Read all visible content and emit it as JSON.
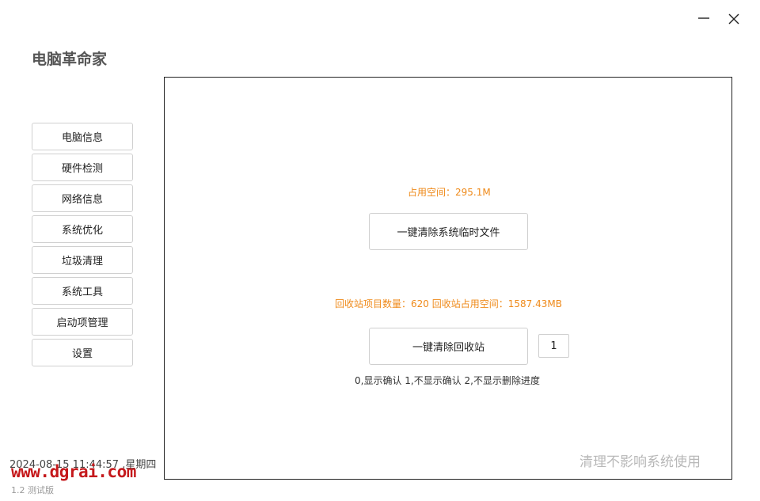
{
  "window": {
    "minimize_icon": "minimize-icon",
    "close_icon": "close-icon"
  },
  "app": {
    "title": "电脑革命家"
  },
  "nav": {
    "items": [
      {
        "label": "电脑信息"
      },
      {
        "label": "硬件检测"
      },
      {
        "label": "网络信息"
      },
      {
        "label": "系统优化"
      },
      {
        "label": "垃圾清理"
      },
      {
        "label": "系统工具"
      },
      {
        "label": "启动项管理"
      },
      {
        "label": "设置"
      }
    ]
  },
  "main": {
    "temp_size": "占用空间：295.1M",
    "clean_temp_label": "一键清除系统临时文件",
    "recycle_info": "回收站项目数量：620  回收站占用空间：1587.43MB",
    "clean_recycle_label": "一键清除回收站",
    "mode_value": "1",
    "mode_hint": "0,显示确认  1,不显示确认  2,不显示删除进度",
    "footer_note": "清理不影响系统使用"
  },
  "status": {
    "datetime": "2024-08-15 11:44:57 ,星期四",
    "site_logo": "www.dgrai.com",
    "version": "1.2  测试版"
  },
  "colors": {
    "accent_orange": "#ef8a1a",
    "logo_red": "#c5191c"
  }
}
